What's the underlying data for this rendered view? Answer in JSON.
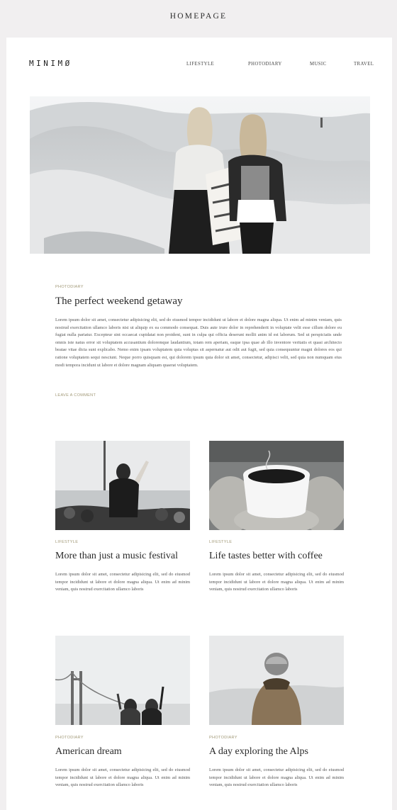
{
  "page_label": "HOMEPAGE",
  "site": {
    "logo": "MINIMØ"
  },
  "nav": {
    "items": [
      "LIFESTYLE",
      "PHOTODIARY",
      "MUSIC",
      "TRAVEL"
    ]
  },
  "featured": {
    "category": "PHOTODIARY",
    "title": "The perfect weekend getaway",
    "body": "Lorem ipsum dolor sit amet, consectetur adipisicing elit, sed do eiusmod tempor incididunt ut labore et dolore magna aliqua. Ut enim ad minim veniam, quis nostrud exercitation ullamco laboris nisi ut aliquip ex ea commodo consequat. Duis aute irure dolor in reprehenderit in voluptate velit esse cillum dolore eu fugiat nulla pariatur. Excepteur sint occaecat cupidatat non proident, sunt in culpa qui officia deserunt mollit anim id est laborum. Sed ut perspiciatis unde omnis iste natus error sit voluptatem accusantium doloremque laudantium, totam rem aperiam, eaque ipsa quae ab illo inventore veritatis et quasi architecto beatae vitae dicta sunt explicabo. Nemo enim ipsam voluptatem quia voluptas sit aspernatur aut odit aut fugit, sed quia consequuntur magni dolores eos qui ratione voluptatem sequi nesciunt. Neque porro quisquam est, qui dolorem ipsum quia dolor sit amet, consectetur, adipisci velit, sed quia non numquam eius modi tempora incidunt ut labore et dolore magnam aliquam quaerat voluptatem.",
    "comment_link": "LEAVE A COMMENT"
  },
  "posts": [
    {
      "category": "LIFESTYLE",
      "title": "More than just a music festival",
      "excerpt": "Lorem ipsum dolor sit amet, consectetur adipisicing elit, sed do eiusmod tempor incididunt ut labore et dolore magna aliqua. Ut enim ad minim veniam, quis nostrud exercitation ullamco laboris"
    },
    {
      "category": "LIFESTYLE",
      "title": "Life tastes better with coffee",
      "excerpt": "Lorem ipsum dolor sit amet, consectetur adipisicing elit, sed do eiusmod tempor incididunt ut labore et dolore magna aliqua. Ut enim ad minim veniam, quis nostrud exercitation ullamco laboris"
    },
    {
      "category": "PHOTODIARY",
      "title": "American dream",
      "excerpt": "Lorem ipsum dolor sit amet, consectetur adipisicing elit, sed do eiusmod tempor incididunt ut labore et dolore magna aliqua. Ut enim ad minim veniam, quis nostrud exercitation ullamco laboris"
    },
    {
      "category": "PHOTODIARY",
      "title": "A day exploring the Alps",
      "excerpt": "Lorem ipsum dolor sit amet, consectetur adipisicing elit, sed do eiusmod tempor incididunt ut labore et dolore magna aliqua. Ut enim ad minim veniam, quis nostrud exercitation ullamco laboris"
    }
  ]
}
